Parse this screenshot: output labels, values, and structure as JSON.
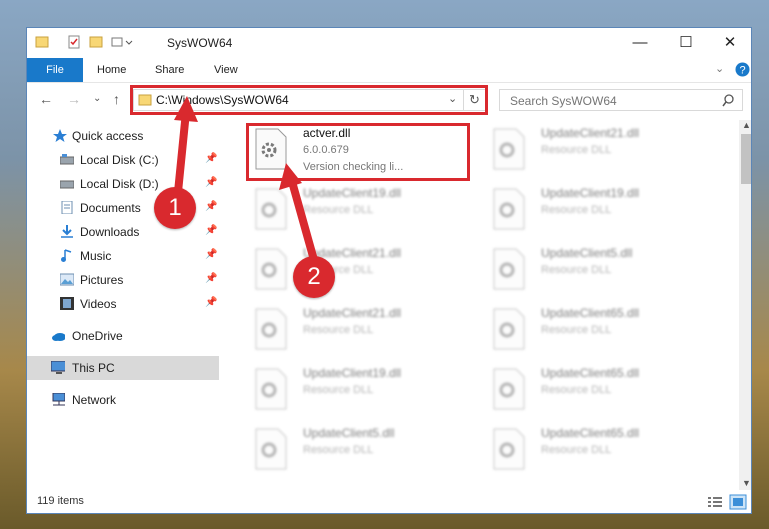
{
  "window": {
    "title": "SysWOW64",
    "ribbon_tabs": [
      "File",
      "Home",
      "Share",
      "View"
    ],
    "controls": {
      "minimize": "—",
      "maximize": "☐",
      "close": "✕"
    }
  },
  "address": {
    "path": "C:\\Windows\\SysWOW64",
    "search_placeholder": "Search SysWOW64"
  },
  "sidebar": {
    "items": [
      {
        "label": "Quick access",
        "icon": "star-icon"
      },
      {
        "label": "Local Disk (C:)",
        "icon": "drive-icon"
      },
      {
        "label": "Local Disk (D:)",
        "icon": "drive-icon"
      },
      {
        "label": "Documents",
        "icon": "documents-icon"
      },
      {
        "label": "Downloads",
        "icon": "download-icon"
      },
      {
        "label": "Music",
        "icon": "music-icon"
      },
      {
        "label": "Pictures",
        "icon": "pictures-icon"
      },
      {
        "label": "Videos",
        "icon": "videos-icon"
      },
      {
        "label": "OneDrive",
        "icon": "cloud-icon"
      },
      {
        "label": "This PC",
        "icon": "computer-icon"
      },
      {
        "label": "Network",
        "icon": "network-icon"
      }
    ]
  },
  "files": {
    "selected": {
      "name": "actver.dll",
      "version": "6.0.0.679",
      "description": "Version checking li..."
    },
    "blurred": [
      {
        "name": "UpdateClient21.dll",
        "type": "Resource DLL"
      },
      {
        "name": "UpdateClient19.dll",
        "type": "Resource DLL"
      },
      {
        "name": "UpdateClient19.dll",
        "type": "Resource DLL"
      },
      {
        "name": "UpdateClient21.dll",
        "type": "Resource DLL"
      },
      {
        "name": "UpdateClient5.dll",
        "type": "Resource DLL"
      },
      {
        "name": "UpdateClient21.dll",
        "type": "Resource DLL"
      },
      {
        "name": "UpdateClient65.dll",
        "type": "Resource DLL"
      },
      {
        "name": "UpdateClient19.dll",
        "type": "Resource DLL"
      },
      {
        "name": "UpdateClient65.dll",
        "type": "Resource DLL"
      },
      {
        "name": "UpdateClient5.dll",
        "type": "Resource DLL"
      },
      {
        "name": "UpdateClient65.dll",
        "type": "Resource DLL"
      }
    ]
  },
  "status": {
    "item_count": "119 items"
  },
  "markers": [
    "1",
    "2"
  ],
  "colors": {
    "highlight": "#d9292e",
    "file_tab": "#1979ca",
    "selection": "#d9d9d9"
  }
}
